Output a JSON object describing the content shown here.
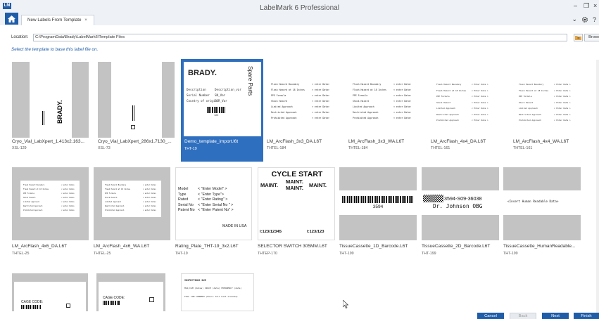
{
  "window": {
    "title": "LabelMark 6 Professional",
    "logo": "LM",
    "tab_label": "New Labels From Template",
    "tab_close": "×",
    "minimize": "–",
    "restore": "❐",
    "close": "×",
    "tab_menu": "⌄",
    "settings_icon": "gear-icon",
    "help": "?"
  },
  "location": {
    "label": "Location:",
    "path": "C:\\ProgramData\\Brady\\LabelMark6\\Template Files",
    "browse_label": "Browse..."
  },
  "instruction": "Select the template to base this label file on.",
  "templates": [
    {
      "name": "Cryo_Vial_LabXpert_1.413x2.163...",
      "sub": "XSL-129"
    },
    {
      "name": "Cryo_Vial_LabXpert_286x1.7130_...",
      "sub": "XSL-73"
    },
    {
      "name": "Demo_template_import.l6t",
      "sub": "THT-19",
      "selected": true
    },
    {
      "name": "LM_ArcFlash_3x3_DA.L6T",
      "sub": "THTEL-184"
    },
    {
      "name": "LM_ArcFlash_3x3_WA.L6T",
      "sub": "THTEL-184"
    },
    {
      "name": "LM_ArcFlash_4x4_DA.L6T",
      "sub": "THTEL-161"
    },
    {
      "name": "LM_ArcFlash_4x4_WA.L6T",
      "sub": "THTEL-161"
    },
    {
      "name": "LM_ArcFlash_4x6_DA.L6T",
      "sub": "THTEL-25"
    },
    {
      "name": "LM_ArcFlash_4x6_WA.L6T",
      "sub": "THTEL-25"
    },
    {
      "name": "Rating_Plate_THT-19_3x2.L6T",
      "sub": "THT-19"
    },
    {
      "name": "SELECTOR SWITCH 305MM.L6T",
      "sub": "THTEP-170"
    },
    {
      "name": "TissueCassette_1D_Barcode.L6T",
      "sub": "THT-199"
    },
    {
      "name": "TissueCassette_2D_Barcode.L6T",
      "sub": "THT-199"
    },
    {
      "name": "TissueCassette_HumanReadable...",
      "sub": "THT-199"
    }
  ],
  "previews": {
    "brady_logo": "BRADY.",
    "brady_side": "Spare Parts",
    "brady_description": "Description",
    "brady_description_var": "Description_var",
    "brady_serial": "Serial Number",
    "brady_serial_var": "SN_Var",
    "brady_country": "Country of origin",
    "brady_country_var": "COR_Var",
    "brady_barcode_text": "123",
    "vial_brand": "BRADY.",
    "arc_lines": [
      "Flash Hazard Boundary",
      "Flash Hazard at 18 Inches",
      "PPE Formula",
      "Shock Hazard",
      "Limited Approach",
      "Restricted Approach",
      "Prohibited Approach"
    ],
    "arc_value": "< enter Data>",
    "arc_value_small": "< Enter Data >",
    "rating_rows": [
      {
        "k": "Model",
        "v": "< \"Enter Model\" >"
      },
      {
        "k": "Type",
        "v": "< \"Enter Type\">"
      },
      {
        "k": "Rated",
        "v": "< \"Enter Rating\" >"
      },
      {
        "k": "Serial No",
        "v": "< \"Enter Serial No \" >"
      },
      {
        "k": "Patent No",
        "v": "< \"Enter Patent No\" >"
      }
    ],
    "rating_footer": "MADE IN USA",
    "selector_title": "CYCLE START",
    "selector_main_top": "MAINT.",
    "selector_main_bottom": "MAINT.",
    "selector_left": "MAINT.",
    "selector_right": "MAINT.",
    "selector_bottom_left": "I:123/12345",
    "selector_bottom_right": "I:123/123",
    "cassette_1d_text": "3594",
    "cassette_2d_code": "3594-S09-36038",
    "cassette_2d_name": "Dr. Johnson OBG",
    "cassette_hr_text": "<Insert Human Readable Data>",
    "cage_code": "CAGE CODE:",
    "instr_title": "INSPECTIONS DUE",
    "instr_line1": "MAJ/CAM (dates)  SPACE (date)  FREQUENCY (date)",
    "instr_line2": "FULL CAB CURRENT (Hours Toll Last scanned)"
  },
  "buttons": {
    "cancel": "Cancel",
    "back": "Back",
    "next": "Next",
    "finish": "Finish"
  }
}
